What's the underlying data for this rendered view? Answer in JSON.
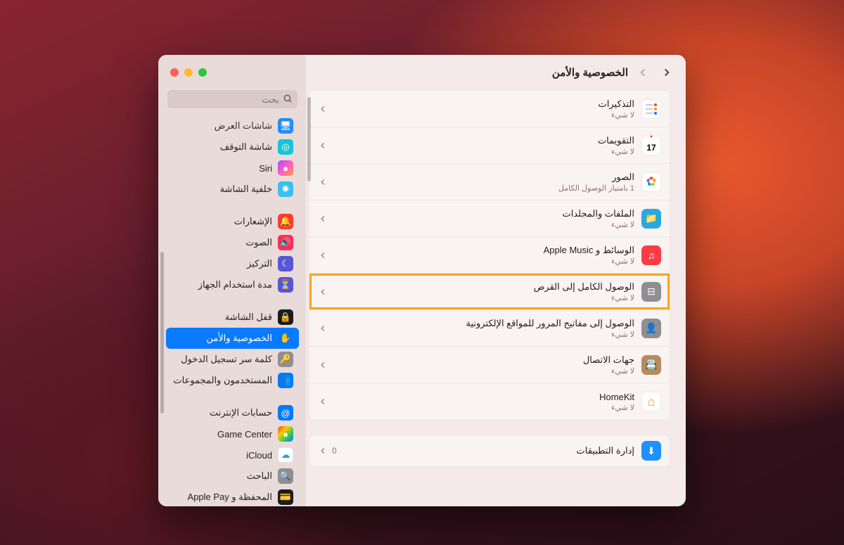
{
  "window": {
    "title": "الخصوصية والأمن"
  },
  "search": {
    "placeholder": "بحث"
  },
  "sidebar": {
    "top_partial": "شاشات العرض",
    "items": [
      {
        "label": "شاشة التوقف",
        "icon": "screensaver-icon",
        "color": "#16c6d6"
      },
      {
        "label": "Siri",
        "icon": "siri-icon",
        "color": "linear-gradient(135deg,#a848ff,#ff5ec2,#ff9a3c)"
      },
      {
        "label": "خلفية الشاشة",
        "icon": "wallpaper-icon",
        "color": "#39bff0"
      }
    ],
    "group2": [
      {
        "label": "الإشعارات",
        "icon": "bell-icon",
        "color": "#ff3b30"
      },
      {
        "label": "الصوت",
        "icon": "sound-icon",
        "color": "#ff2d55"
      },
      {
        "label": "التركيز",
        "icon": "moon-icon",
        "color": "#5856d6"
      },
      {
        "label": "مدة استخدام الجهاز",
        "icon": "hourglass-icon",
        "color": "#5856d6"
      }
    ],
    "group3": [
      {
        "label": "قفل الشاشة",
        "icon": "lock-icon",
        "color": "#1c1c1e"
      },
      {
        "label": "الخصوصية والأمن",
        "icon": "hand-icon",
        "color": "#007aff",
        "active": true
      },
      {
        "label": "كلمة سر تسجيل الدخول",
        "icon": "key-icon",
        "color": "#8e8e93"
      },
      {
        "label": "المستخدمون والمجموعات",
        "icon": "users-icon",
        "color": "#007aff"
      }
    ],
    "group4": [
      {
        "label": "حسابات الإنترنت",
        "icon": "at-icon",
        "color": "#007aff"
      },
      {
        "label": "Game Center",
        "icon": "gamecenter-icon",
        "color": "linear-gradient(135deg,#ff3b30,#ffcc00,#34c759,#007aff)"
      },
      {
        "label": "iCloud",
        "icon": "cloud-icon",
        "color": "#ffffff"
      },
      {
        "label": "الباحث",
        "icon": "spotlight-icon",
        "color": "#8e8e93"
      },
      {
        "label": "المحفظة و Apple Pay",
        "icon": "wallet-icon",
        "color": "#1c1c1e"
      }
    ]
  },
  "privacy_rows": [
    {
      "title": "التذكيرات",
      "sub": "لا شيء",
      "icon": "reminders-icon",
      "color": "#ffffff"
    },
    {
      "title": "التقويمات",
      "sub": "لا شيء",
      "icon": "calendar-icon",
      "color": "#ffffff",
      "badge_text": "17"
    },
    {
      "title": "الصور",
      "sub": "1 بامتياز الوصول الكامل",
      "icon": "photos-icon",
      "color": "#ffffff"
    },
    {
      "title": "الملفات والمجلدات",
      "sub": "لا شيء",
      "icon": "folder-icon",
      "color": "#2aa8e0"
    },
    {
      "title": "الوسائط و Apple Music",
      "sub": "لا شيء",
      "icon": "music-icon",
      "color": "#fc3c44"
    },
    {
      "title": "الوصول الكامل إلى القرص",
      "sub": "لا شيء",
      "icon": "disk-icon",
      "color": "#8e8e93",
      "highlighted": true
    },
    {
      "title": "الوصول إلى مفاتيح المرور للمواقع الإلكترونية",
      "sub": "لا شيء",
      "icon": "passkey-icon",
      "color": "#8e8e93"
    },
    {
      "title": "جهات الاتصال",
      "sub": "لا شيء",
      "icon": "contacts-icon",
      "color": "#b98a5a"
    },
    {
      "title": "HomeKit",
      "sub": "لا شيء",
      "icon": "home-icon",
      "color": "#ffffff"
    }
  ],
  "section2": [
    {
      "title": "إدارة التطبيقات",
      "icon": "appstore-icon",
      "color": "#1e90ff",
      "badge": "0"
    }
  ]
}
